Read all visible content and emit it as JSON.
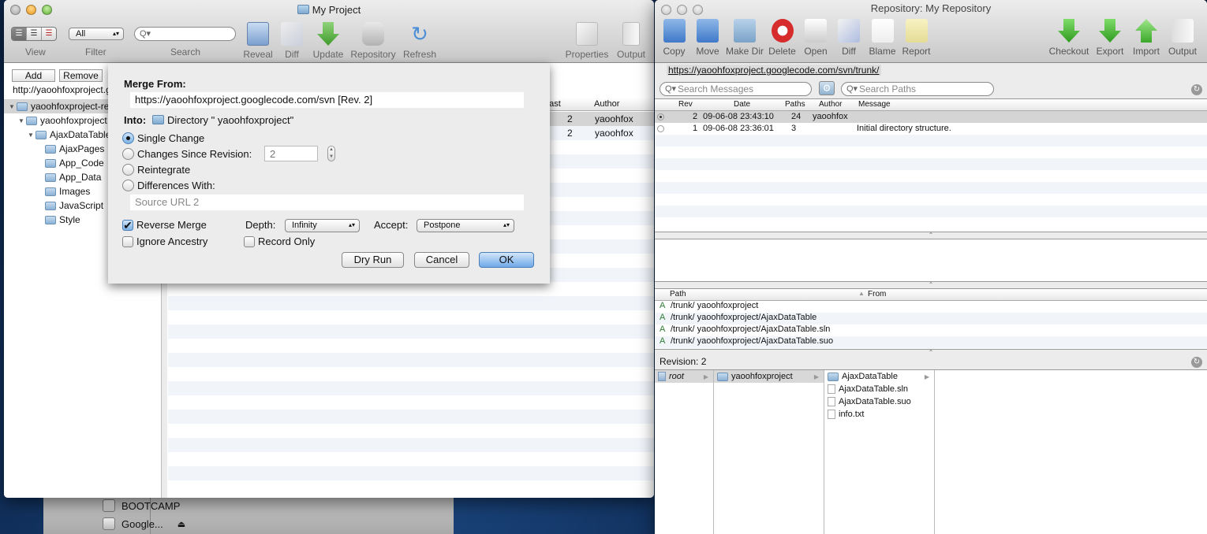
{
  "desktop": {
    "devices": [
      {
        "label": "BOOTCAMP",
        "icon": "hard-disk-icon",
        "eject": false
      },
      {
        "label": "Google...",
        "icon": "disk-image-icon",
        "eject": true
      }
    ]
  },
  "project_window": {
    "title": "My Project",
    "toolbar": {
      "view_label": "View",
      "filter_label": "Filter",
      "filter_value": "All",
      "search_label": "Search",
      "search_placeholder": "",
      "tools": [
        {
          "label": "Reveal",
          "icon": "finder-icon"
        },
        {
          "label": "Diff",
          "icon": "diff-icon"
        },
        {
          "label": "Update",
          "icon": "update-arrow-icon"
        },
        {
          "label": "Repository",
          "icon": "repository-icon"
        },
        {
          "label": "Refresh",
          "icon": "refresh-icon"
        },
        {
          "label": "Properties",
          "icon": "properties-icon"
        },
        {
          "label": "Output",
          "icon": "output-icon"
        }
      ]
    },
    "sidebar": {
      "add_label": "Add",
      "remove_label": "Remove",
      "url": "http://yaoohfoxproject.googlecode.com/svn/trunk/",
      "tree": [
        {
          "label": "yaoohfoxproject-read-only",
          "level": 0,
          "expanded": true,
          "selected": true
        },
        {
          "label": "yaoohfoxproject",
          "level": 1,
          "expanded": true
        },
        {
          "label": "AjaxDataTable",
          "level": 2,
          "expanded": true
        },
        {
          "label": "AjaxPages",
          "level": 3
        },
        {
          "label": "App_Code",
          "level": 3
        },
        {
          "label": "App_Data",
          "level": 3
        },
        {
          "label": "Images",
          "level": 3
        },
        {
          "label": "JavaScript",
          "level": 3
        },
        {
          "label": "Style",
          "level": 3
        }
      ]
    },
    "file_table": {
      "columns": [
        "Last",
        "Author"
      ],
      "rows": [
        {
          "last": "2",
          "author": "yaoohfox"
        },
        {
          "last": "2",
          "author": "yaoohfox"
        }
      ]
    }
  },
  "merge_sheet": {
    "merge_from_label": "Merge From:",
    "merge_from_value": "https://yaoohfoxproject.googlecode.com/svn  [Rev. 2]",
    "into_label": "Into:",
    "into_value": "Directory \" yaoohfoxproject\"",
    "options": [
      {
        "label": "Single Change",
        "selected": true
      },
      {
        "label": "Changes Since Revision:",
        "selected": false
      },
      {
        "label": "Reintegrate",
        "selected": false
      },
      {
        "label": "Differences With:",
        "selected": false
      }
    ],
    "since_revision_value": "2",
    "source_url_placeholder": "Source URL 2",
    "reverse_merge_label": "Reverse Merge",
    "reverse_merge_checked": true,
    "ignore_ancestry_label": "Ignore Ancestry",
    "ignore_ancestry_checked": false,
    "depth_label": "Depth:",
    "depth_value": "Infinity",
    "record_only_label": "Record Only",
    "record_only_checked": false,
    "accept_label": "Accept:",
    "accept_value": "Postpone",
    "dry_run_label": "Dry Run",
    "cancel_label": "Cancel",
    "ok_label": "OK"
  },
  "repo_window": {
    "title": "Repository: My Repository",
    "tools_left": [
      {
        "label": "Copy",
        "icon": "copy-icon"
      },
      {
        "label": "Move",
        "icon": "move-icon"
      },
      {
        "label": "Make Dir",
        "icon": "make-dir-icon"
      },
      {
        "label": "Delete",
        "icon": "delete-icon"
      },
      {
        "label": "Open",
        "icon": "open-icon"
      },
      {
        "label": "Diff",
        "icon": "diff-icon"
      },
      {
        "label": "Blame",
        "icon": "blame-icon"
      },
      {
        "label": "Report",
        "icon": "report-icon"
      }
    ],
    "tools_right": [
      {
        "label": "Checkout",
        "icon": "checkout-icon"
      },
      {
        "label": "Export",
        "icon": "export-icon"
      },
      {
        "label": "Import",
        "icon": "import-icon"
      },
      {
        "label": "Output",
        "icon": "output-icon"
      }
    ],
    "url": "https://yaoohfoxproject.googlecode.com/svn/trunk/",
    "search_messages_placeholder": "Search Messages",
    "search_paths_placeholder": "Search Paths",
    "log_columns": [
      "Rev",
      "Date",
      "Paths",
      "Author",
      "Message"
    ],
    "log_rows": [
      {
        "rev": "2",
        "date": "09-06-08 23:43:10",
        "paths": "24",
        "author": "yaoohfox",
        "message": "",
        "selected": true
      },
      {
        "rev": "1",
        "date": "09-06-08 23:36:01",
        "paths": "3",
        "author": "",
        "message": "Initial directory structure.",
        "selected": false
      }
    ],
    "path_columns": [
      "Path",
      "From"
    ],
    "path_rows": [
      {
        "action": "A",
        "path": "/trunk/ yaoohfoxproject"
      },
      {
        "action": "A",
        "path": "/trunk/ yaoohfoxproject/AjaxDataTable"
      },
      {
        "action": "A",
        "path": "/trunk/ yaoohfoxproject/AjaxDataTable.sln"
      },
      {
        "action": "A",
        "path": "/trunk/ yaoohfoxproject/AjaxDataTable.suo"
      }
    ],
    "revision_label": "Revision:",
    "revision_value": "2",
    "browser": {
      "col1": [
        {
          "label": "root",
          "selected": true
        }
      ],
      "col2": [
        {
          "label": "yaoohfoxproject",
          "selected": true
        }
      ],
      "col3": [
        {
          "label": "AjaxDataTable",
          "type": "folder"
        },
        {
          "label": "AjaxDataTable.sln",
          "type": "file"
        },
        {
          "label": "AjaxDataTable.suo",
          "type": "file"
        },
        {
          "label": "info.txt",
          "type": "text"
        }
      ]
    }
  }
}
